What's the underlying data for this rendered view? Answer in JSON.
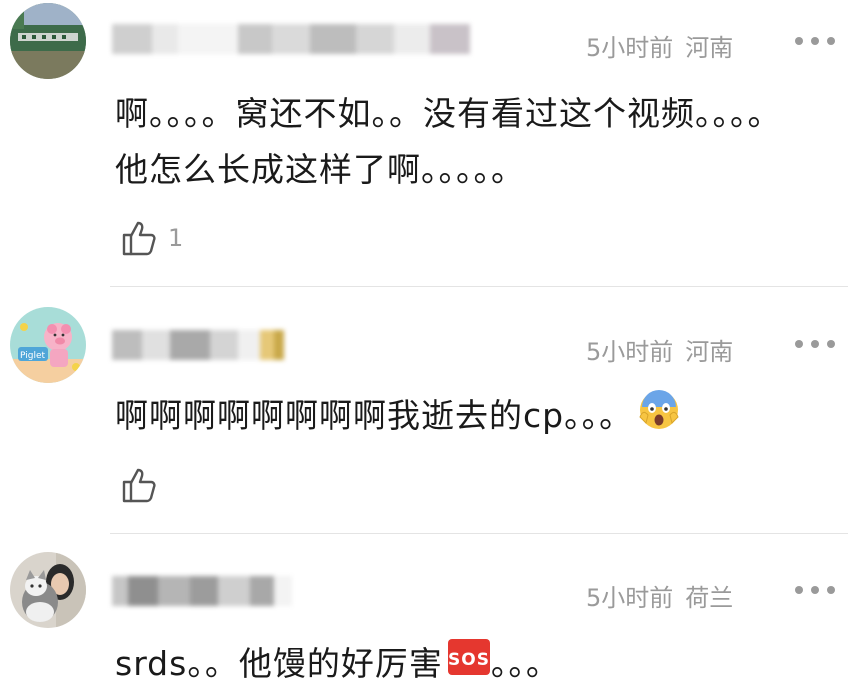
{
  "comments": [
    {
      "time": "5小时前",
      "location": "河南",
      "text": "啊。。。。窝还不如。。没有看过这个视频。。。。他怎么长成这样了啊。。。。。",
      "likes": "1",
      "avatar_icon": "field-photo-avatar"
    },
    {
      "time": "5小时前",
      "location": "河南",
      "text": "啊啊啊啊啊啊啊啊我逝去的cp。。。",
      "emoji": "face-screaming-in-fear-emoji",
      "likes": "",
      "avatar_icon": "cartoon-pig-avatar"
    },
    {
      "time": "5小时前",
      "location": "荷兰",
      "text_before": "srds。。他馒的好厉害",
      "emoji": "sos-button-emoji",
      "text_after": "。。。",
      "likes": "",
      "avatar_icon": "person-with-cat-avatar"
    }
  ],
  "colors": {
    "meta_text": "#9a9a9a",
    "body_text": "#1a1a1a",
    "divider": "#e4e4e4"
  }
}
